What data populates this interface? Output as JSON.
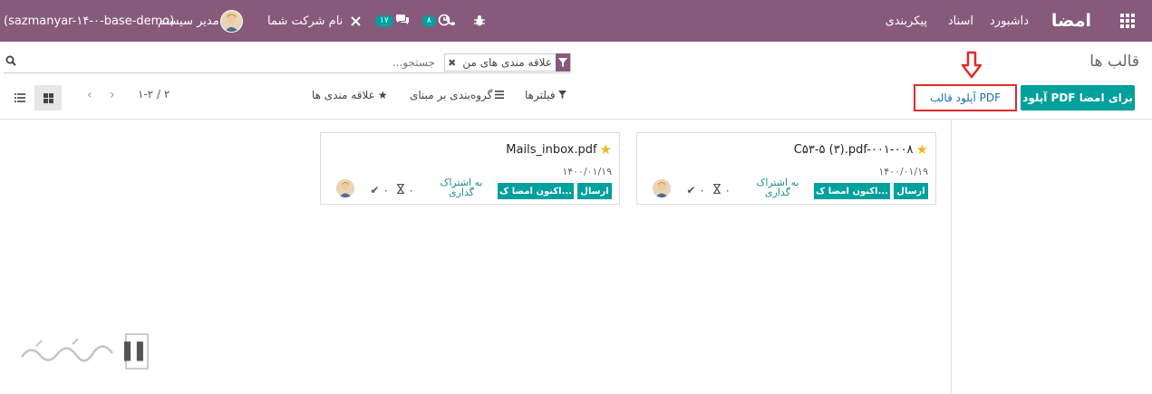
{
  "navbar": {
    "brand": "امضا",
    "menu": [
      "داشبورد",
      "اسناد",
      "پیکربندی"
    ],
    "company": "نام شرکت شما",
    "user_name": "مدیر سیستم",
    "db_name": "(sazmanyar-۱۴-۰-base-demo)",
    "messages_count": "۱۷",
    "activities_count": "۸",
    "accent_color": "#875a7b"
  },
  "page": {
    "breadcrumb": "قالب ها"
  },
  "search": {
    "placeholder": "جستجو...",
    "facet_label": "علاقه مندی های من"
  },
  "actions": {
    "upload_sign": "آپلود PDF برای امضا",
    "upload_template": "آپلود قالب PDF"
  },
  "controls": {
    "filters": "فیلترها",
    "group_by": "گروه‌بندی بر مبنای",
    "favorites": "علاقه مندی ها",
    "pager": "۱-۲ / ۲"
  },
  "cards": [
    {
      "title": "C۵۳-۵ (۳).pdf-۰۰۱-۰۰۸",
      "date": "۱۴۰۰/۰۱/۱۹",
      "send": "ارسال",
      "sign_now": "اکنون امضا ک...",
      "share_line1": "به اشتراک",
      "share_line2": "گذاری",
      "count_a": "۰",
      "count_b": "۰"
    },
    {
      "title": "Mails_inbox.pdf",
      "date": "۱۴۰۰/۰۱/۱۹",
      "send": "ارسال",
      "sign_now": "اکنون امضا ک...",
      "share_line1": "به اشتراک",
      "share_line2": "گذاری",
      "count_a": "۰",
      "count_b": "۰"
    }
  ],
  "icons": {
    "apps": "apps-grid-icon",
    "search": "search-icon",
    "filter": "filter-icon",
    "star": "star-icon",
    "list_view": "list-view-icon",
    "kanban_view": "kanban-view-icon"
  }
}
